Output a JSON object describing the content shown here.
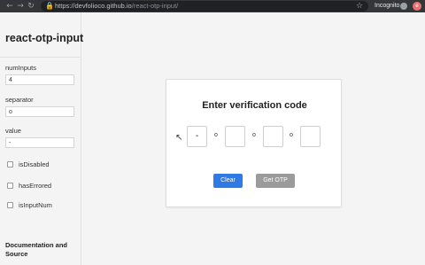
{
  "browser": {
    "url_host": "https://devfolioco.github.io",
    "url_path": "/react-otp-input/",
    "incognito_label": "Incognito",
    "profile_initial": "e"
  },
  "sidebar": {
    "title": "react-otp-input",
    "fields": [
      {
        "label": "numInputs",
        "value": "4"
      },
      {
        "label": "separator",
        "value": "o"
      },
      {
        "label": "value",
        "value": "-"
      }
    ],
    "checkboxes": [
      {
        "label": "isDisabled",
        "checked": false
      },
      {
        "label": "hasErrored",
        "checked": false
      },
      {
        "label": "isInputNum",
        "checked": false
      }
    ],
    "docs_link": "Documentation and Source"
  },
  "card": {
    "title": "Enter verification code",
    "otp_values": [
      "-",
      "",
      "",
      ""
    ],
    "separator": "o",
    "clear_label": "Clear",
    "get_otp_label": "Get OTP"
  },
  "colors": {
    "clear_button": "#2f7be5",
    "get_otp_button": "#9b9b9b",
    "chrome": "#35363a"
  }
}
